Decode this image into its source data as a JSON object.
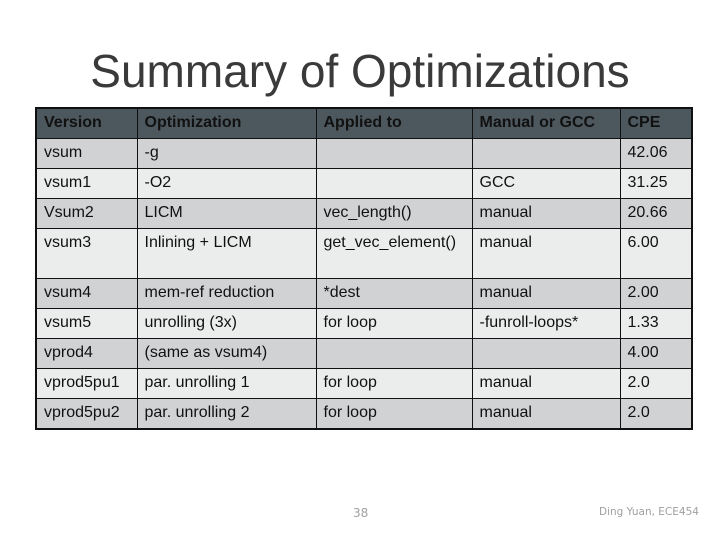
{
  "title": "Summary of Optimizations",
  "table": {
    "headers": [
      "Version",
      "Optimization",
      "Applied to",
      "Manual or GCC",
      "CPE"
    ],
    "rows": [
      [
        "vsum",
        "-g",
        "",
        "",
        "42.06"
      ],
      [
        "vsum1",
        "-O2",
        "",
        "GCC",
        "31.25"
      ],
      [
        "Vsum2",
        "LICM",
        "vec_length()",
        "manual",
        "20.66"
      ],
      [
        "vsum3",
        "Inlining + LICM",
        "get_vec_element()",
        "manual",
        "6.00"
      ],
      [
        "vsum4",
        "mem-ref reduction",
        "*dest",
        "manual",
        "2.00"
      ],
      [
        "vsum5",
        "unrolling (3x)",
        "for loop",
        "-funroll-loops*",
        "1.33"
      ],
      [
        "vprod4",
        "(same as vsum4)",
        "",
        "",
        "4.00"
      ],
      [
        "vprod5pu1",
        "par. unrolling 1",
        "for loop",
        "manual",
        "2.0"
      ],
      [
        "vprod5pu2",
        "par. unrolling 2",
        "for loop",
        "manual",
        "2.0"
      ]
    ]
  },
  "footer": {
    "page_number": "38",
    "credit": "Ding Yuan, ECE454"
  },
  "colors": {
    "header_bg": "#4d585e",
    "row_grey": "#d1d2d4",
    "row_light": "#ebecec",
    "title": "#3a3a3a",
    "footer_text": "#a0a0a0"
  }
}
